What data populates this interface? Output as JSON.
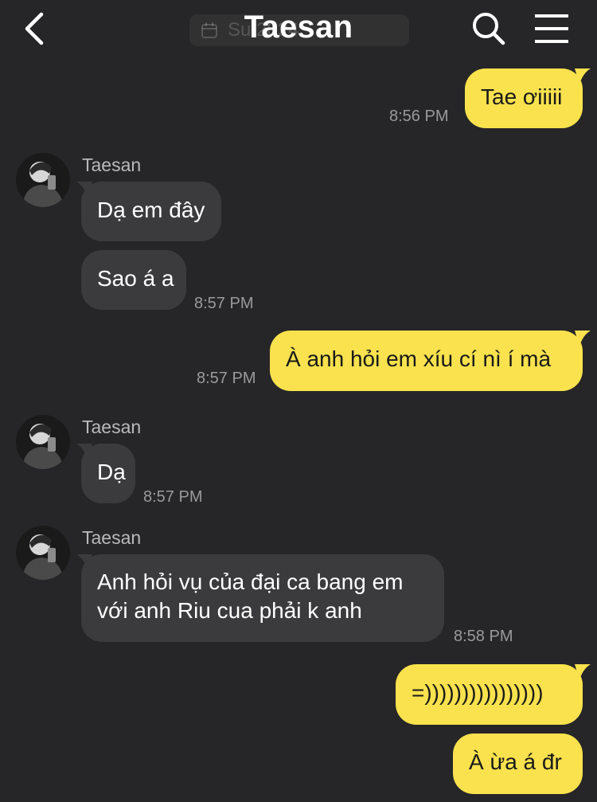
{
  "header": {
    "title": "Taesan",
    "date_ghost": "Su 2024",
    "back_icon": "chevron-left-icon",
    "search_icon": "search-icon",
    "menu_icon": "menu-icon"
  },
  "colors": {
    "background": "#262628",
    "outgoing_bubble": "#f9e24d",
    "incoming_bubble": "#3b3b3d",
    "timestamp": "#9a9a9c"
  },
  "messages": [
    {
      "direction": "out",
      "text": "Tae ơiiiii",
      "time": "8:56 PM"
    },
    {
      "direction": "in",
      "sender": "Taesan",
      "text": "Dạ em đây"
    },
    {
      "direction": "in",
      "text": "Sao á a",
      "time": "8:57 PM"
    },
    {
      "direction": "out",
      "text": "À anh hỏi em xíu cí nì í mà",
      "time": "8:57 PM"
    },
    {
      "direction": "in",
      "sender": "Taesan",
      "text": "Dạ",
      "time": "8:57 PM"
    },
    {
      "direction": "in",
      "sender": "Taesan",
      "text_line1": "Anh hỏi vụ của đại ca bang em",
      "text_line2": "với anh Riu cua phải k anh",
      "time": "8:58 PM"
    },
    {
      "direction": "out",
      "text": "=))))))))))))))))"
    },
    {
      "direction": "out",
      "text": "À ừa á đr"
    }
  ]
}
